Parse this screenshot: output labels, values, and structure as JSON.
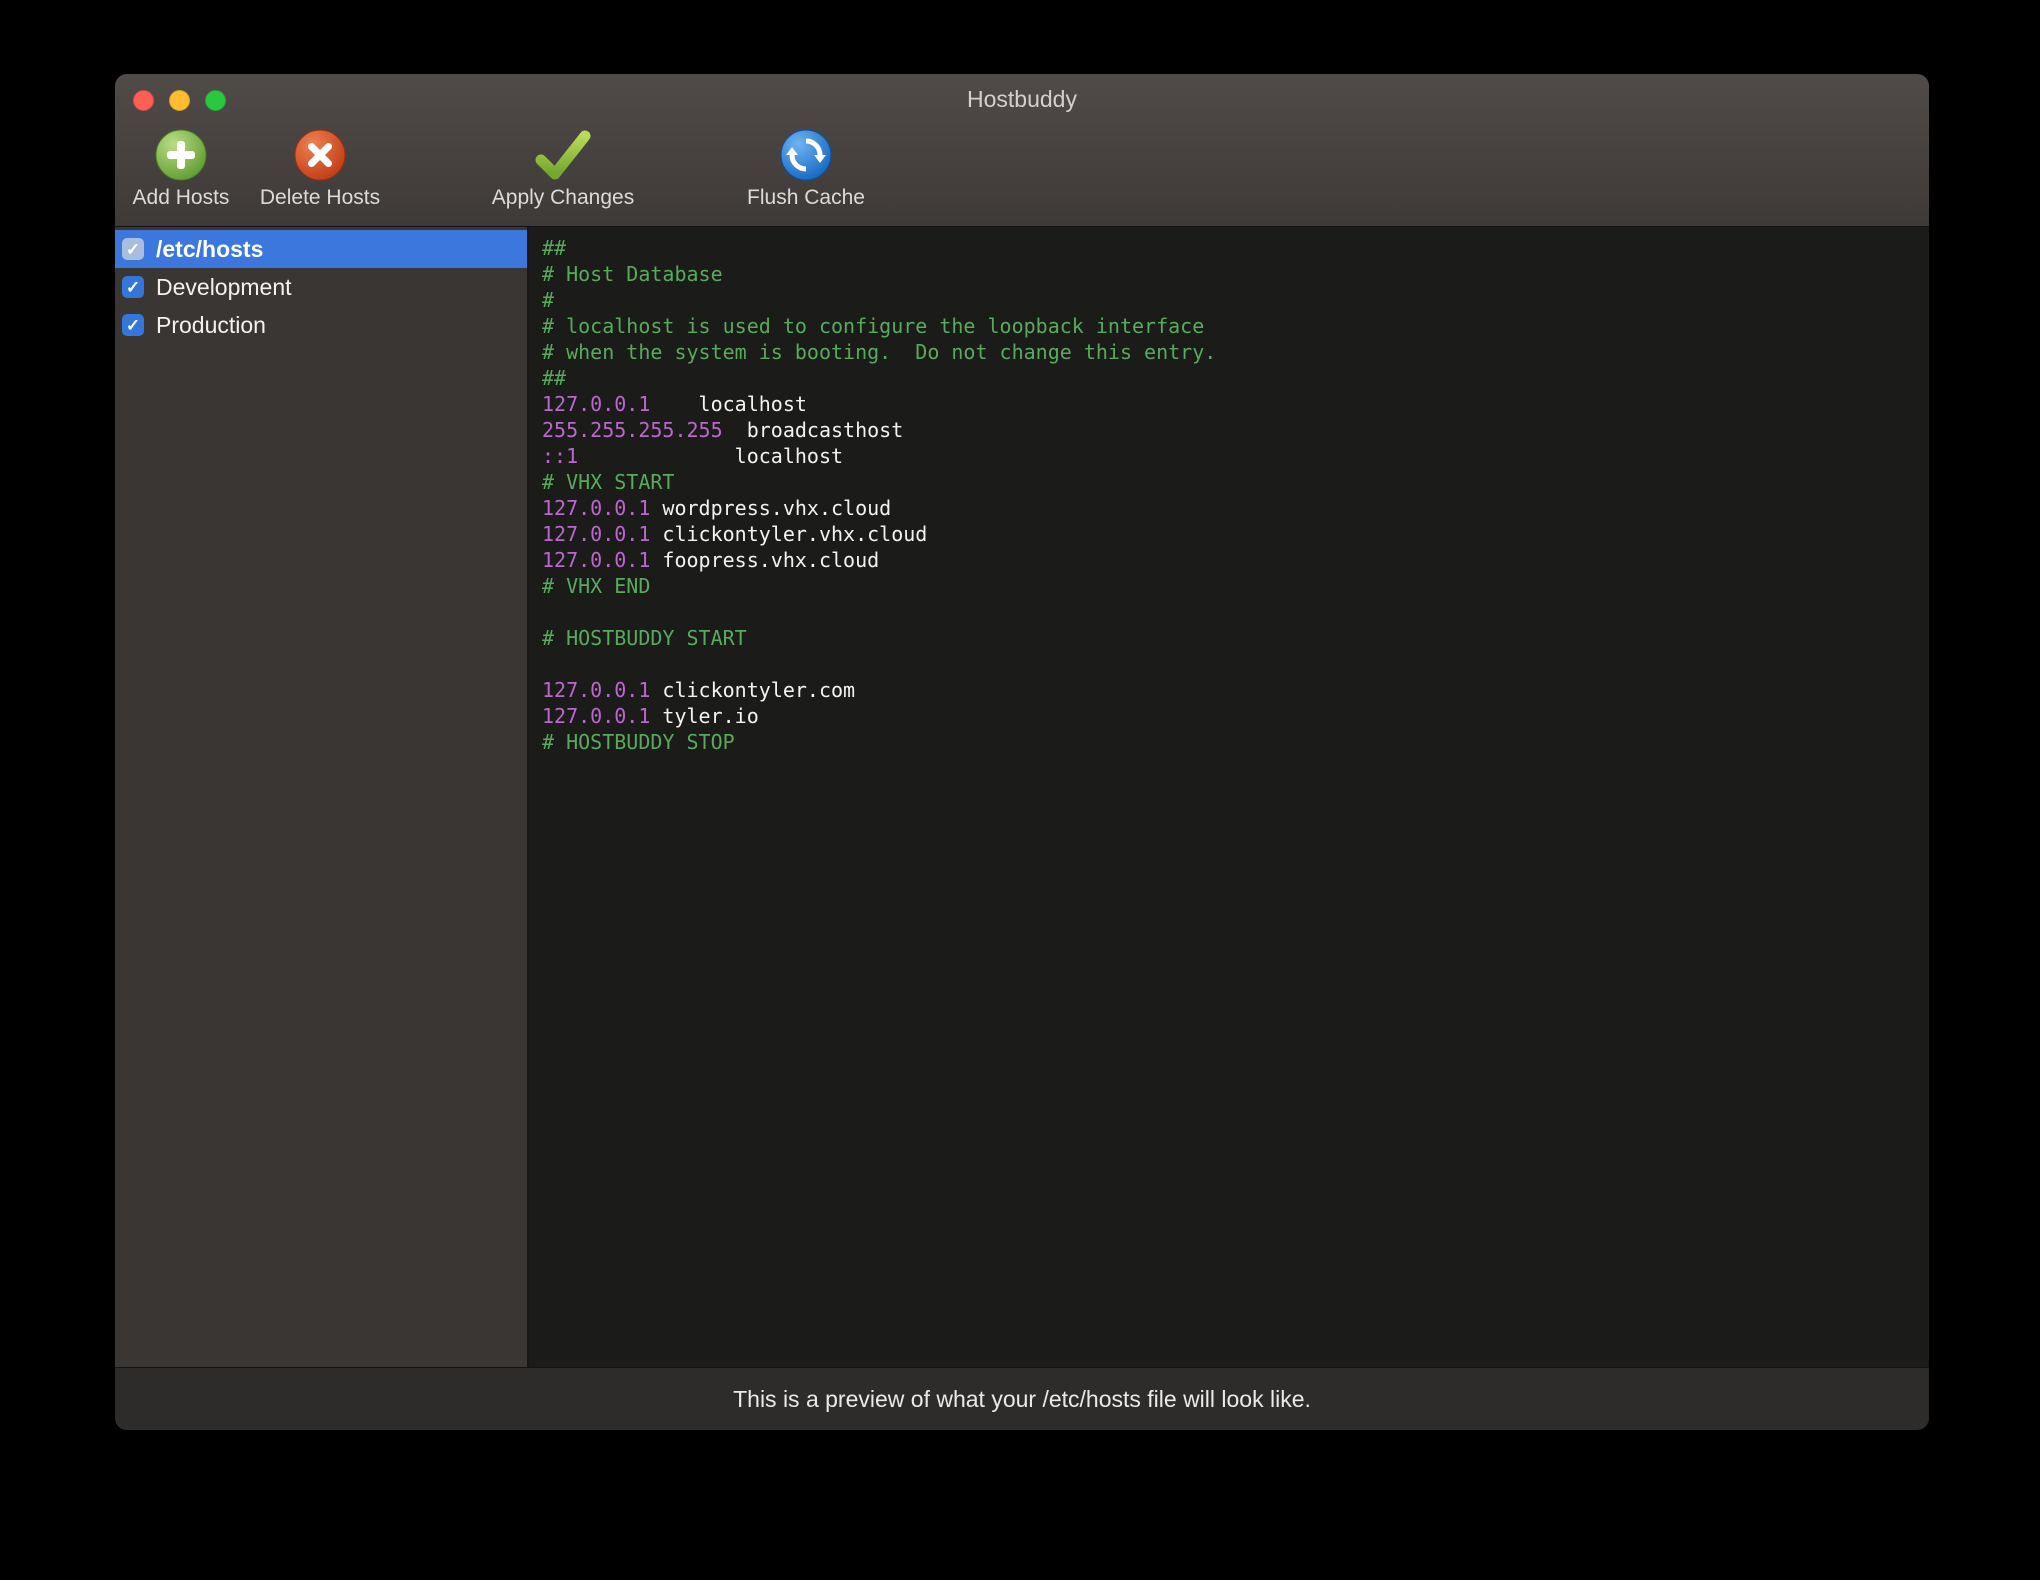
{
  "window": {
    "title": "Hostbuddy"
  },
  "toolbar": {
    "add_label": "Add Hosts",
    "delete_label": "Delete Hosts",
    "apply_label": "Apply Changes",
    "flush_label": "Flush Cache"
  },
  "sidebar": {
    "items": [
      {
        "label": "/etc/hosts",
        "checked": true,
        "selected": true
      },
      {
        "label": "Development",
        "checked": true,
        "selected": false
      },
      {
        "label": "Production",
        "checked": true,
        "selected": false
      }
    ]
  },
  "editor": {
    "lines": [
      [
        {
          "t": "comment",
          "s": "##"
        }
      ],
      [
        {
          "t": "comment",
          "s": "# Host Database"
        }
      ],
      [
        {
          "t": "comment",
          "s": "#"
        }
      ],
      [
        {
          "t": "comment",
          "s": "# localhost is used to configure the loopback interface"
        }
      ],
      [
        {
          "t": "comment",
          "s": "# when the system is booting.  Do not change this entry."
        }
      ],
      [
        {
          "t": "comment",
          "s": "##"
        }
      ],
      [
        {
          "t": "ip",
          "s": "127.0.0.1"
        },
        {
          "t": "host",
          "s": "    localhost"
        }
      ],
      [
        {
          "t": "ip",
          "s": "255.255.255.255"
        },
        {
          "t": "host",
          "s": "  broadcasthost"
        }
      ],
      [
        {
          "t": "ip",
          "s": "::1"
        },
        {
          "t": "host",
          "s": "             localhost"
        }
      ],
      [
        {
          "t": "comment",
          "s": "# VHX START"
        }
      ],
      [
        {
          "t": "ip",
          "s": "127.0.0.1"
        },
        {
          "t": "host",
          "s": " wordpress.vhx.cloud"
        }
      ],
      [
        {
          "t": "ip",
          "s": "127.0.0.1"
        },
        {
          "t": "host",
          "s": " clickontyler.vhx.cloud"
        }
      ],
      [
        {
          "t": "ip",
          "s": "127.0.0.1"
        },
        {
          "t": "host",
          "s": " foopress.vhx.cloud"
        }
      ],
      [
        {
          "t": "comment",
          "s": "# VHX END"
        }
      ],
      [],
      [
        {
          "t": "comment",
          "s": "# HOSTBUDDY START"
        }
      ],
      [],
      [
        {
          "t": "ip",
          "s": "127.0.0.1"
        },
        {
          "t": "host",
          "s": " clickontyler.com"
        }
      ],
      [
        {
          "t": "ip",
          "s": "127.0.0.1"
        },
        {
          "t": "host",
          "s": " tyler.io"
        }
      ],
      [
        {
          "t": "comment",
          "s": "# HOSTBUDDY STOP"
        }
      ]
    ]
  },
  "statusbar": {
    "text": "This is a preview of what your /etc/hosts file will look like."
  },
  "colors": {
    "comment": "#58ab5c",
    "ip": "#bd66cf",
    "host": "#f5f3f1",
    "selection": "#3b77dd",
    "checkbox": "#3476d9"
  }
}
